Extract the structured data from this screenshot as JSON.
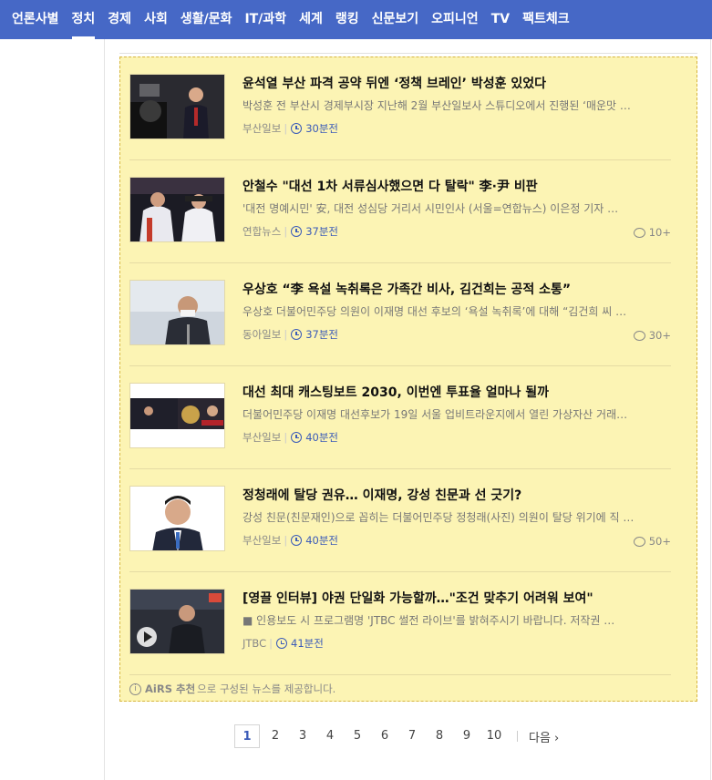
{
  "nav": {
    "items": [
      "언론사별",
      "정치",
      "경제",
      "사회",
      "생활/문화",
      "IT/과학",
      "세계",
      "랭킹",
      "신문보기",
      "오피니언",
      "TV",
      "팩트체크"
    ],
    "active": "정치"
  },
  "colors": {
    "nav_bg": "#4668c6",
    "panel_bg": "#fcf4b4",
    "accent": "#3b5bb8"
  },
  "news": [
    {
      "title": "윤석열 부산 파격 공약 뒤엔 ‘정책 브레인’ 박성훈 있었다",
      "desc": "박성훈 전 부산시 경제부시장 지난해 2월 부산일보사 스튜디오에서 진행된 ‘매운맛 …",
      "source": "부산일보",
      "time": "30분전",
      "comments": ""
    },
    {
      "title": "안철수 \"대선 1차 서류심사했으면 다 탈락\" 李·尹 비판",
      "desc": "'대전 명예시민' 安, 대전 성심당 거리서 시민인사 (서울=연합뉴스) 이은정 기자 …",
      "source": "연합뉴스",
      "time": "37분전",
      "comments": "10+"
    },
    {
      "title": "우상호 “李 욕설 녹취록은 가족간 비사, 김건희는 공적 소통”",
      "desc": "우상호 더불어민주당 의원이 이재명 대선 후보의 ‘욕설 녹취록’에 대해 “김건희 씨 …",
      "source": "동아일보",
      "time": "37분전",
      "comments": "30+"
    },
    {
      "title": "대선 최대 캐스팅보트 2030, 이번엔 투표율 얼마나 될까",
      "desc": "더불어민주당 이재명 대선후보가 19일 서울 업비트라운지에서 열린 가상자산 거래소 …",
      "source": "부산일보",
      "time": "40분전",
      "comments": ""
    },
    {
      "title": "정청래에 탈당 권유… 이재명, 강성 친문과 선 긋기?",
      "desc": "강성 친문(친문재인)으로 꼽히는 더불어민주당 정청래(사진) 의원이 탈당 위기에 직 …",
      "source": "부산일보",
      "time": "40분전",
      "comments": "50+"
    },
    {
      "title": "[영끌 인터뷰] 야권 단일화 가능할까…\"조건 맞추기 어려워 보여\"",
      "desc": "■ 인용보도 시 프로그램명 'JTBC 썰전 라이브'를 밝혀주시기 바랍니다. 저작권 …",
      "source": "JTBC",
      "time": "41분전",
      "comments": ""
    }
  ],
  "airs": {
    "brand": "AiRS 추천",
    "text": "으로 구성된 뉴스를 제공합니다."
  },
  "pager": {
    "pages": [
      "1",
      "2",
      "3",
      "4",
      "5",
      "6",
      "7",
      "8",
      "9",
      "10"
    ],
    "current": "1",
    "next": "다음"
  }
}
